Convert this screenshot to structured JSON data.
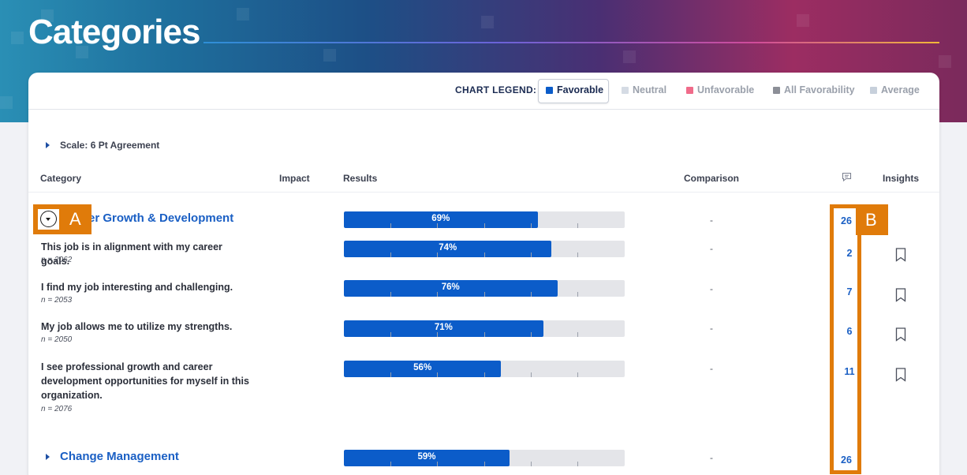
{
  "page": {
    "title": "Categories"
  },
  "legend": {
    "label": "CHART LEGEND:",
    "items": [
      {
        "label": "Favorable",
        "color": "#0b5cc9",
        "active": true
      },
      {
        "label": "Neutral",
        "color": "#d5dbe4",
        "active": false
      },
      {
        "label": "Unfavorable",
        "color": "#f06b8a",
        "active": false
      },
      {
        "label": "All Favorability",
        "color": "#8c8f97",
        "active": false
      },
      {
        "label": "Average",
        "color": "#c7d0db",
        "active": false
      }
    ]
  },
  "scale": {
    "label": "Scale: 6 Pt Agreement"
  },
  "columns": {
    "category": "Category",
    "impact": "Impact",
    "results": "Results",
    "comparison": "Comparison",
    "comments_icon": "comment-icon",
    "insights": "Insights"
  },
  "categories": [
    {
      "title": "er Growth & Development",
      "favorable": 69,
      "favorable_label": "69%",
      "comparison": "-",
      "comments": "26",
      "questions": [
        {
          "text": "This job is in alignment with my career goals.",
          "n": "n = 2062",
          "favorable": 74,
          "favorable_label": "74%",
          "comparison": "-",
          "comments": "2"
        },
        {
          "text": "I find my job interesting and challenging.",
          "n": "n = 2053",
          "favorable": 76,
          "favorable_label": "76%",
          "comparison": "-",
          "comments": "7"
        },
        {
          "text": "My job allows me to utilize my strengths.",
          "n": "n = 2050",
          "favorable": 71,
          "favorable_label": "71%",
          "comparison": "-",
          "comments": "6"
        },
        {
          "text": "I see professional growth and career development opportunities for myself in this organization.",
          "n": "n = 2076",
          "favorable": 56,
          "favorable_label": "56%",
          "comparison": "-",
          "comments": "11"
        }
      ]
    },
    {
      "title": "Change Management",
      "favorable": 59,
      "favorable_label": "59%",
      "comparison": "-",
      "comments": "26",
      "questions": []
    }
  ],
  "annotations": {
    "a": "A",
    "b": "B",
    "color": "#e07b0a"
  }
}
